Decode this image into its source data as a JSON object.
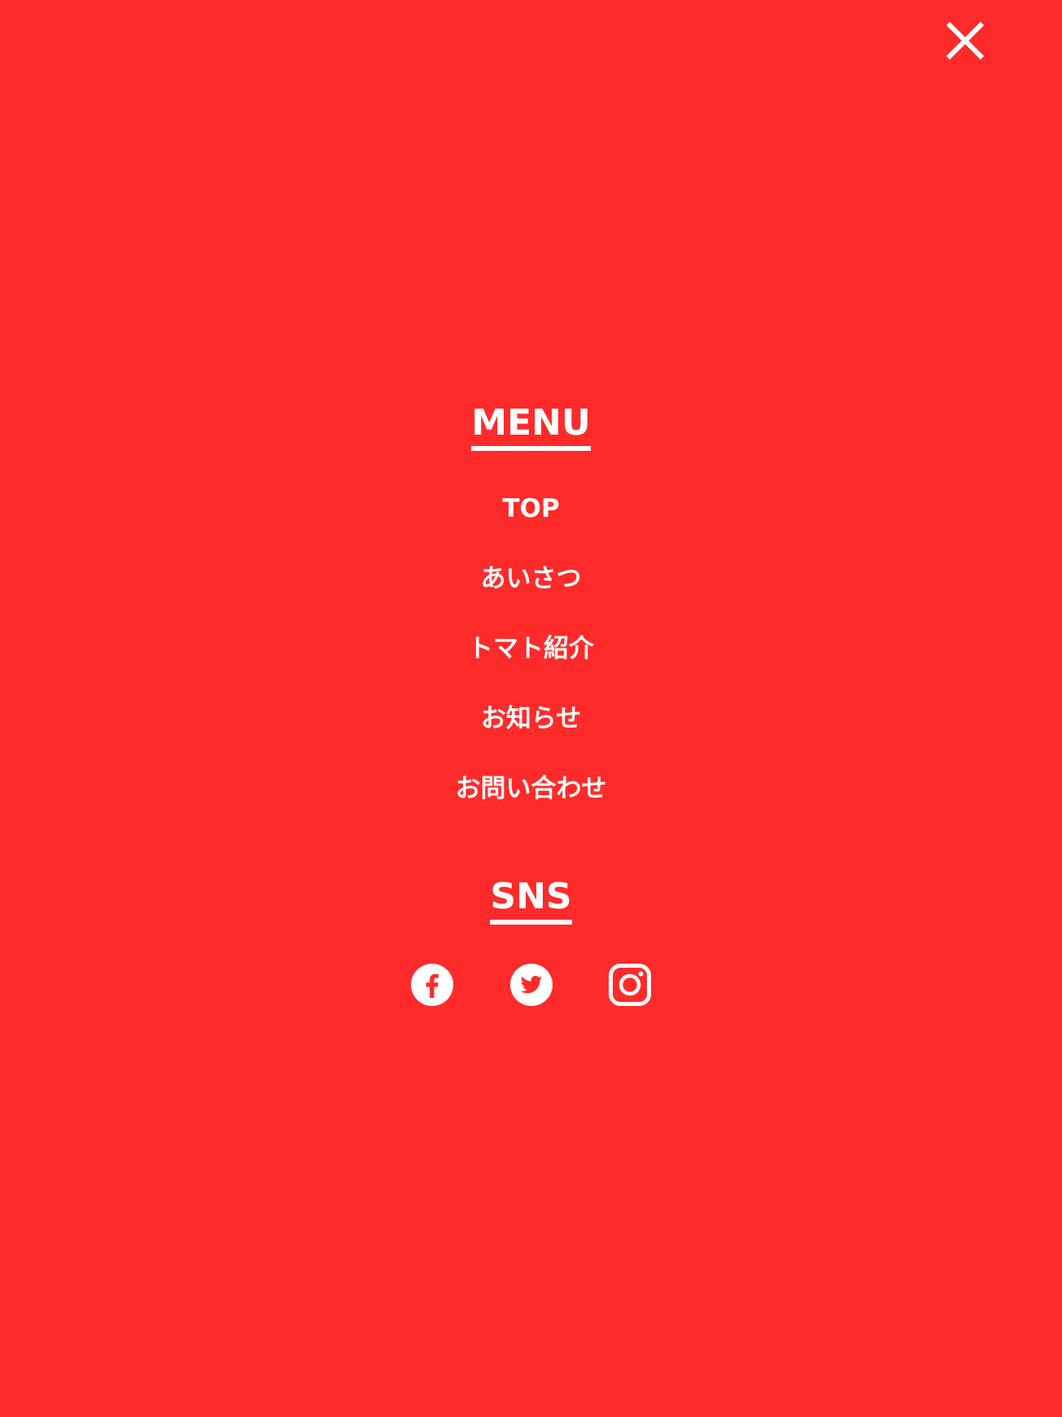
{
  "close": {
    "icon": "close-icon"
  },
  "menu": {
    "title": "MENU",
    "items": [
      {
        "label": "TOP"
      },
      {
        "label": "あいさつ"
      },
      {
        "label": "トマト紹介"
      },
      {
        "label": "お知らせ"
      },
      {
        "label": "お問い合わせ"
      }
    ]
  },
  "sns": {
    "title": "SNS",
    "icons": [
      {
        "name": "facebook-icon"
      },
      {
        "name": "twitter-icon"
      },
      {
        "name": "instagram-icon"
      }
    ]
  },
  "colors": {
    "background": "#ff2a2a",
    "foreground": "#ffffff"
  }
}
